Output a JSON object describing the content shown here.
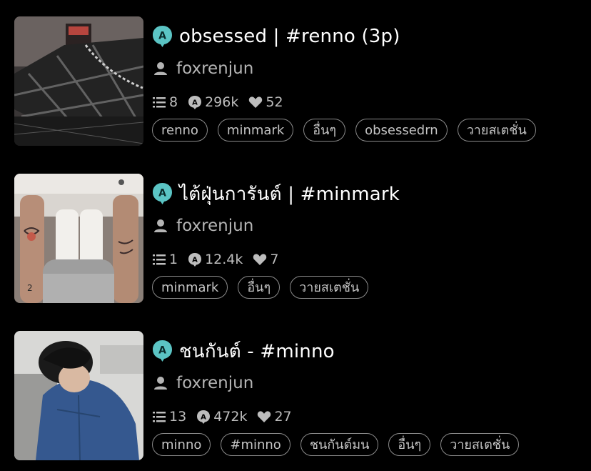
{
  "colors": {
    "background": "#000000",
    "badge": "#5bc4c4",
    "title": "#ffffff",
    "meta": "#b4b4b4",
    "tag_border": "#8a8a8a"
  },
  "icons": {
    "badge": "completed-badge-icon",
    "author": "person-icon",
    "parts": "list-icon",
    "reads": "reads-badge-icon",
    "votes": "heart-icon"
  },
  "stories": [
    {
      "title": "obsessed | #renno (3p)",
      "author": "foxrenjun",
      "parts": "8",
      "reads": "296k",
      "votes": "52",
      "tags": [
        "renno",
        "minmark",
        "อื่นๆ",
        "obsessedrn",
        "วายสเตชั่น"
      ]
    },
    {
      "title": "ไต้ฝุ่นการันต์ | #minmark",
      "author": "foxrenjun",
      "parts": "1",
      "reads": "12.4k",
      "votes": "7",
      "tags": [
        "minmark",
        "อื่นๆ",
        "วายสเตชั่น"
      ]
    },
    {
      "title": "ชนกันต์ - #minno",
      "author": "foxrenjun",
      "parts": "13",
      "reads": "472k",
      "votes": "27",
      "tags": [
        "minno",
        "#minno",
        "ชนกันต์มน",
        "อื่นๆ",
        "วายสเตชั่น"
      ]
    }
  ]
}
